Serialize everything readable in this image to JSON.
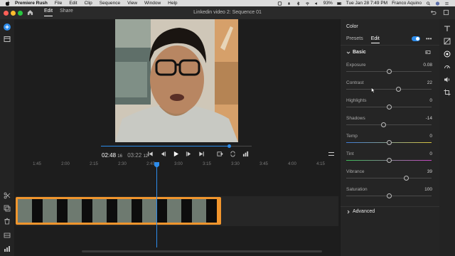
{
  "menubar": {
    "app_name": "Premiere Rush",
    "items": [
      "File",
      "Edit",
      "Clip",
      "Sequence",
      "View",
      "Window",
      "Help"
    ],
    "battery": "93%",
    "datetime": "Tue Jan 28  7:49 PM",
    "user": "Franco Aquino"
  },
  "titlebar": {
    "tabs": [
      "Edit",
      "Share"
    ],
    "active_tab": "Edit",
    "document_title": "Linkedin video 2: Sequence 01"
  },
  "player": {
    "current_time": "02:48",
    "current_frames": "16",
    "duration": "03:22",
    "duration_frames": "12",
    "progress_fraction": 0.85
  },
  "timeline": {
    "ticks": [
      "1:45",
      "2:00",
      "2:15",
      "2:30",
      "2:45",
      "3:00",
      "3:15",
      "3:30",
      "3:45",
      "4:00",
      "4:15"
    ]
  },
  "panel": {
    "title": "Color",
    "tabs": [
      "Presets",
      "Edit"
    ],
    "active_tab": "Edit",
    "more": "•••",
    "section": "Basic",
    "params": [
      {
        "label": "Exposure",
        "value": "0.08",
        "level": 0.5
      },
      {
        "label": "Contrast",
        "value": "22",
        "level": 0.61
      },
      {
        "label": "Highlights",
        "value": "0",
        "level": 0.5
      },
      {
        "label": "Shadows",
        "value": "-14",
        "level": 0.43
      },
      {
        "label": "Temp",
        "value": "0",
        "level": 0.5
      },
      {
        "label": "Tint",
        "value": "0",
        "level": 0.5
      },
      {
        "label": "Vibrance",
        "value": "39",
        "level": 0.7
      },
      {
        "label": "Saturation",
        "value": "100",
        "level": 0.5
      }
    ],
    "advanced": "Advanced"
  },
  "colors": {
    "accent": "#2d8ceb",
    "clip": "#f0952d",
    "background": "#1d1d1d"
  }
}
